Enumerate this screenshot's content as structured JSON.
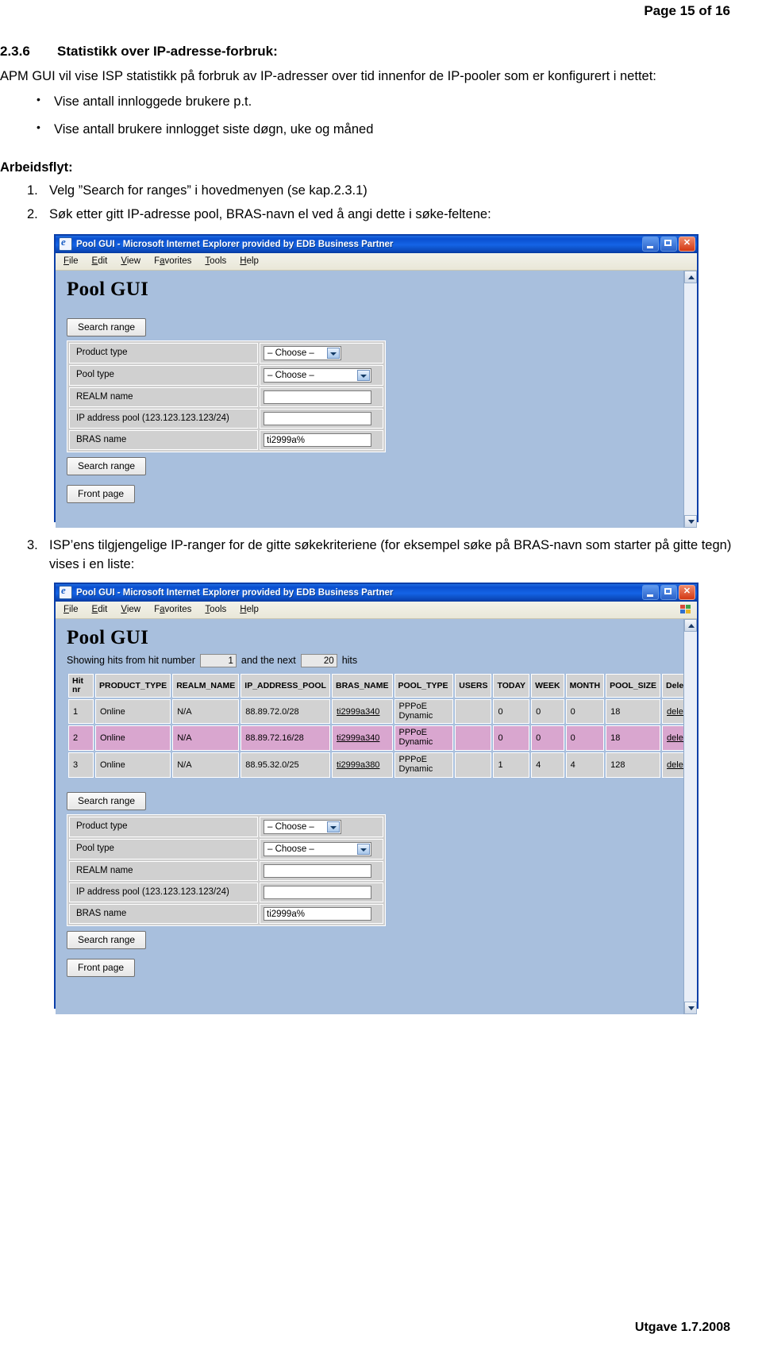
{
  "page": {
    "header": "Page 15 of 16",
    "footer": "Utgave 1.7.2008"
  },
  "section": {
    "number": "2.3.6",
    "title": "Statistikk over IP-adresse-forbruk:",
    "intro": "APM GUI vil vise ISP statistikk på forbruk av IP-adresser over tid innenfor de IP-pooler som er konfigurert i nettet:",
    "bullets": [
      "Vise antall innloggede brukere p.t.",
      "Vise antall brukere innlogget siste døgn, uke og måned"
    ],
    "workflow_heading": "Arbeidsflyt:",
    "steps": [
      {
        "num": "1.",
        "text": "Velg ”Search for ranges” i hovedmenyen (se kap.2.3.1)"
      },
      {
        "num": "2.",
        "text": "Søk etter gitt IP-adresse pool, BRAS-navn el ved å angi dette i søke-feltene:"
      },
      {
        "num": "3.",
        "text": "ISP’ens tilgjengelige IP-ranger for de gitte søkekriteriene (for eksempel søke på BRAS-navn som starter på gitte tegn) vises i en liste:"
      }
    ]
  },
  "browser": {
    "title": "Pool GUI - Microsoft Internet Explorer provided by EDB Business Partner",
    "menu": [
      "File",
      "Edit",
      "View",
      "Favorites",
      "Tools",
      "Help"
    ],
    "window_buttons": [
      "minimize",
      "maximize",
      "close"
    ],
    "app_heading": "Pool GUI"
  },
  "search_form": {
    "search_button_top": "Search range",
    "search_button_bottom": "Search range",
    "front_page_button": "Front page",
    "rows": [
      {
        "label": "Product type",
        "type": "select",
        "value": "– Choose –"
      },
      {
        "label": "Pool type",
        "type": "select",
        "value": "– Choose –"
      },
      {
        "label": "REALM name",
        "type": "text",
        "value": ""
      },
      {
        "label": "IP address pool (123.123.123.123/24)",
        "type": "text",
        "value": ""
      },
      {
        "label": "BRAS name",
        "type": "text",
        "value": "ti2999a%"
      }
    ]
  },
  "results": {
    "showing": {
      "prefix": "Showing hits from hit number",
      "from": "1",
      "middle": "and the next",
      "count": "20",
      "suffix": "hits"
    },
    "columns": [
      "Hit nr",
      "PRODUCT_TYPE",
      "REALM_NAME",
      "IP_ADDRESS_POOL",
      "BRAS_NAME",
      "POOL_TYPE",
      "USERS",
      "TODAY",
      "WEEK",
      "MONTH",
      "POOL_SIZE",
      "Delete"
    ],
    "rows": [
      {
        "hit": "1",
        "product_type": "Online",
        "realm_name": "N/A",
        "ip_address_pool": "88.89.72.0/28",
        "bras_name": "ti2999a340",
        "pool_type": "PPPoE Dynamic",
        "users": "",
        "today": "0",
        "week": "0",
        "month": "0",
        "pool_size": "18",
        "delete": "delete",
        "highlight": false
      },
      {
        "hit": "2",
        "product_type": "Online",
        "realm_name": "N/A",
        "ip_address_pool": "88.89.72.16/28",
        "bras_name": "ti2999a340",
        "pool_type": "PPPoE Dynamic",
        "users": "",
        "today": "0",
        "week": "0",
        "month": "0",
        "pool_size": "18",
        "delete": "delete",
        "highlight": true
      },
      {
        "hit": "3",
        "product_type": "Online",
        "realm_name": "N/A",
        "ip_address_pool": "88.95.32.0/25",
        "bras_name": "ti2999a380",
        "pool_type": "PPPoE Dynamic",
        "users": "",
        "today": "1",
        "week": "4",
        "month": "4",
        "pool_size": "128",
        "delete": "delete",
        "highlight": false
      }
    ]
  },
  "colors": {
    "title_bar": "#0a4fd0",
    "page_bg": "#a8bfdd",
    "table_cell": "#d2d2d2",
    "highlight_row": "#d9a6cf",
    "window_border": "#0b3fa8"
  }
}
